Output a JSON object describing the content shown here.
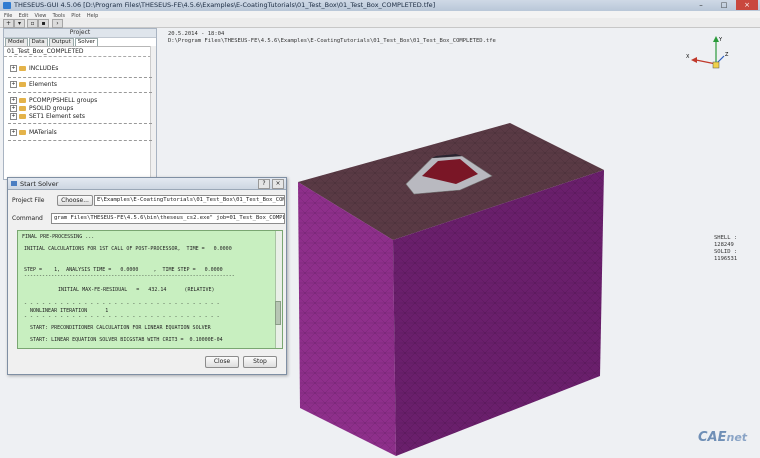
{
  "window": {
    "title": "THESEUS-GUI 4.5.06  [D:\\Program Files\\THESEUS-FE\\4.5.6\\Examples\\E-CoatingTutorials\\01_Test_Box\\01_Test_Box_COMPLETED.tfe]"
  },
  "menu": [
    "File",
    "Edit",
    "View",
    "Tools",
    "Plot",
    "Help"
  ],
  "project_panel": {
    "header": "Project",
    "tabs": [
      "Model",
      "Data",
      "Output",
      "Solver"
    ],
    "active_tab": "Solver",
    "file_name": "01_Test_Box_COMPLETED",
    "items": [
      {
        "label": "INCLUDEs",
        "expander": "+"
      },
      {
        "label": "Elements",
        "expander": "+"
      },
      {
        "label": "PCOMP/PSHELL groups",
        "expander": "+"
      },
      {
        "label": "PSOLID groups",
        "expander": "+"
      },
      {
        "label": "SET1 Element sets",
        "expander": "+"
      },
      {
        "label": "MATerials",
        "expander": "+"
      }
    ]
  },
  "viewport": {
    "date": "20.5.2014 - 18:04",
    "path": "D:\\Program Files\\THESEUS-FE\\4.5.6\\Examples\\E-CoatingTutorials\\01_Test_Box\\01_Test_Box_COMPLETED.tfe",
    "stats": {
      "shell": "SHELL : 128249",
      "solid": "SOLID : 1196531"
    },
    "axis_labels": {
      "y": "Y",
      "x": "X",
      "z": "Z"
    }
  },
  "solver_dialog": {
    "title": "Start Solver",
    "project_file_label": "Project File",
    "choose_button": "Choose...",
    "project_file_value": "E\\Examples\\E-CoatingTutorials\\01_Test_Box\\01_Test_Box_COMPLETED.tfe",
    "command_label": "Command",
    "command_value": "gram Files\\THESEUS-FE\\4.5.6\\bin\\theseus_cs2.exe\" job=01_Test_Box_COMPLETED  inter",
    "output_lines": [
      "FINAL PRE-PROCESSING ...",
      "INITIAL CALCULATIONS FOR 1ST CALL OF POST-PROCESSOR,  TIME =   0.0000",
      "STEP =    1,  ANALYSIS TIME =   0.0000     ,  TIME STEP =   0.0000",
      "----------------------------------------------------------------------",
      "INITIAL MAX-FE-RESIDUAL   =   432.14      (RELATIVE)",
      "- - - - - - - - - - - - - - - - - - - - - - - - - - - - - - - - -",
      "NONLINEAR ITERATION      1",
      "- - - - - - - - - - - - - - - - - - - - - - - - - - - - - - - - -",
      "START: PRECONDITIONER CALCULATION FOR LINEAR EQUATION SOLVER",
      "START: LINEAR EQUATION SOLVER BICGSTAB WITH CRIT3 =  0.10000E-04"
    ],
    "close_button": "Close",
    "stop_button": "Stop"
  },
  "watermark": {
    "brand": "CAE",
    "suffix": "net"
  },
  "colors": {
    "cube_front": "#8e2f8b",
    "cube_side": "#6a1f6c",
    "cube_top": "#5a3a45",
    "output_bg": "#c8efc0"
  }
}
